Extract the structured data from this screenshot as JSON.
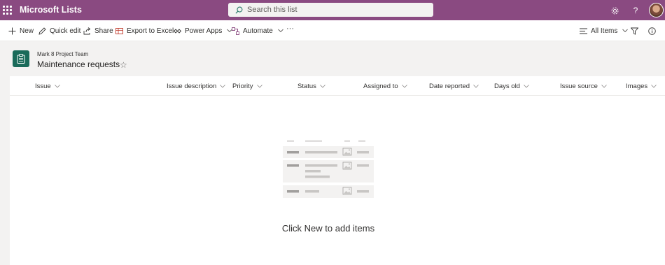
{
  "suite": {
    "app_title": "Microsoft Lists",
    "search_placeholder": "Search this list",
    "icons": [
      "waffle-icon",
      "search-icon",
      "settings-icon",
      "help-icon",
      "avatar"
    ]
  },
  "command_bar": {
    "new_label": "New",
    "quick_edit_label": "Quick edit",
    "share_label": "Share",
    "export_label": "Export to Excel",
    "power_apps_label": "Power Apps",
    "automate_label": "Automate",
    "more_label": "···",
    "view_label": "All Items"
  },
  "header": {
    "site_name": "Mark 8 Project Team",
    "list_title": "Maintenance requests",
    "star": "☆"
  },
  "columns": [
    "Issue",
    "Issue description",
    "Priority",
    "Status",
    "Assigned to",
    "Date reported",
    "Days old",
    "Issue source",
    "Images"
  ],
  "empty_state": {
    "message": "Click New to add items"
  },
  "colors": {
    "suite_bar": "#8a4a81",
    "list_icon": "#1a6b5a",
    "background": "#f3f2f1"
  }
}
